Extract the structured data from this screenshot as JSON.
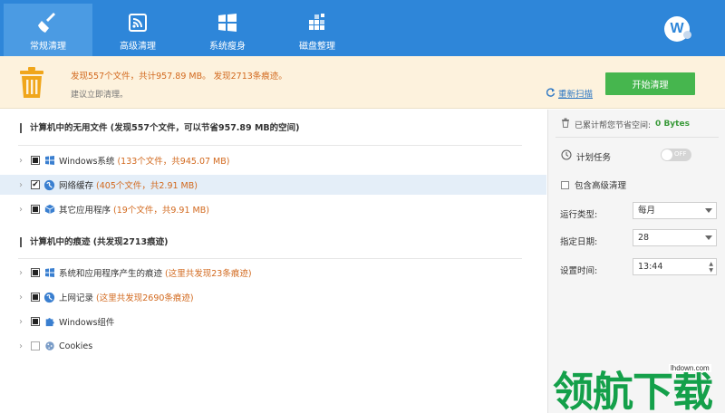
{
  "tabs": [
    {
      "label": "常规清理",
      "icon": "broom-icon"
    },
    {
      "label": "高级清理",
      "icon": "advanced-clean-icon"
    },
    {
      "label": "系统瘦身",
      "icon": "windows-icon"
    },
    {
      "label": "磁盘整理",
      "icon": "disk-defrag-icon"
    }
  ],
  "user": {
    "avatar_letter": "W"
  },
  "banner": {
    "main_text": "发现557个文件，共计957.89 MB。 发现2713条痕迹。",
    "sub_text": "建议立即清理。",
    "rescan_label": "重新扫描",
    "start_label": "开始清理"
  },
  "sections": [
    {
      "title": "计算机中的无用文件 (发现557个文件，可以节省957.89 MB的空间)",
      "items": [
        {
          "name": "Windows系统",
          "detail": "(133个文件，共945.07 MB)",
          "check": "partial",
          "icon": "windows-icon"
        },
        {
          "name": "网络缓存",
          "detail": "(405个文件，共2.91 MB)",
          "check": "checked",
          "icon": "globe-icon"
        },
        {
          "name": "其它应用程序",
          "detail": "(19个文件，共9.91 MB)",
          "check": "partial",
          "icon": "package-icon"
        }
      ]
    },
    {
      "title": "计算机中的痕迹 (共发现2713痕迹)",
      "items": [
        {
          "name": "系统和应用程序产生的痕迹",
          "detail": "(这里共发现23条痕迹)",
          "check": "partial",
          "icon": "windows-icon"
        },
        {
          "name": "上网记录",
          "detail": "(这里共发现2690条痕迹)",
          "check": "partial",
          "icon": "globe-icon"
        },
        {
          "name": "Windows组件",
          "detail": "",
          "check": "partial",
          "icon": "puzzle-icon"
        },
        {
          "name": "Cookies",
          "detail": "",
          "check": "empty",
          "icon": "cookie-icon"
        }
      ]
    }
  ],
  "panel": {
    "saved_prefix": "已累计帮您节省空间:",
    "saved_value": "0 Bytes",
    "schedule_label": "计划任务",
    "toggle_text": "OFF",
    "advanced_label": "包含高级清理",
    "run_type_label": "运行类型:",
    "run_type_value": "每月",
    "date_label": "指定日期:",
    "date_value": "28",
    "time_label": "设置时间:",
    "time_value": "13:44"
  },
  "watermark": {
    "text": "领航下载",
    "url": "lhdown.com"
  },
  "colors": {
    "header": "#2e86d9",
    "accent_orange": "#d2691e",
    "start_green": "#46b64e",
    "saved_green": "#3a9a3a"
  }
}
